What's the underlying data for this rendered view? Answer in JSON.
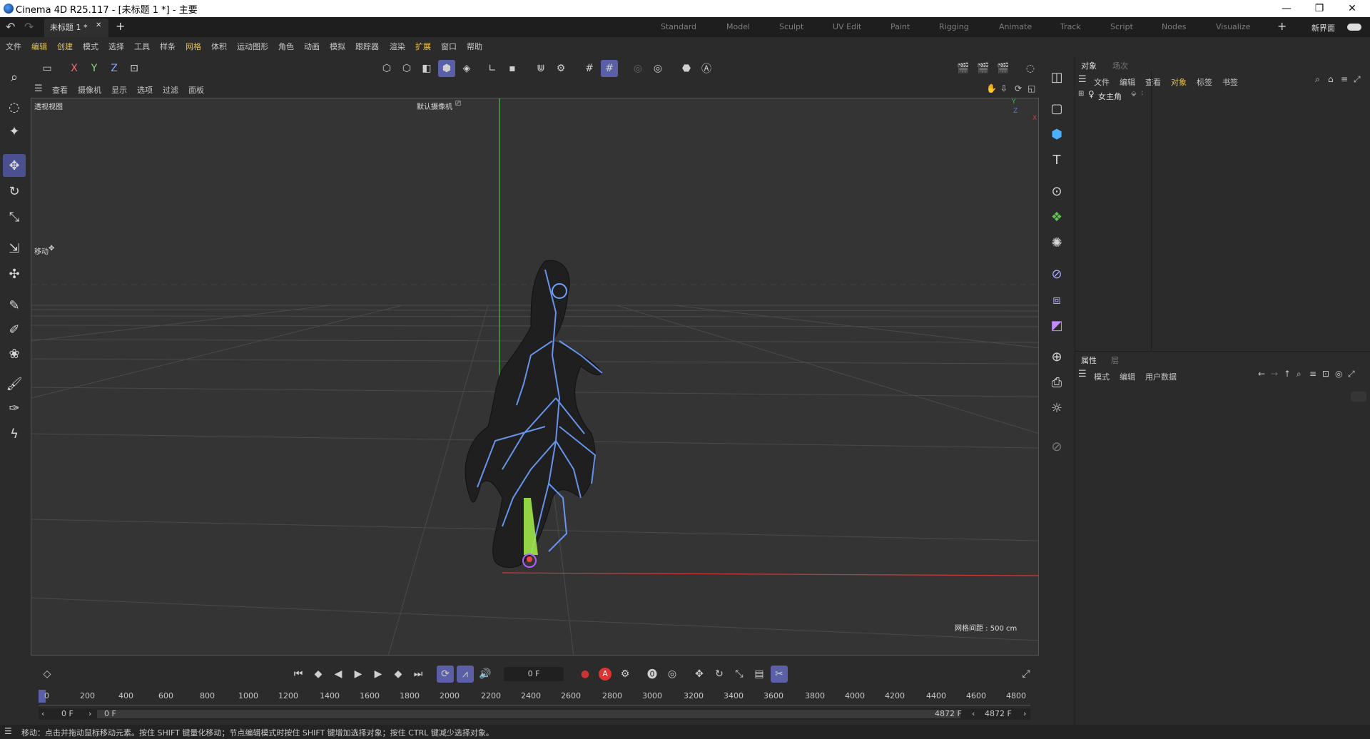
{
  "titlebar": {
    "title": "Cinema 4D R25.117 - [未标题 1 *] - 主要",
    "minimize": "—",
    "restore": "❐",
    "close": "✕"
  },
  "tabs": {
    "doc_tab": "未标题 1 *",
    "doc_close": "✕",
    "add": "+",
    "layouts": [
      "Standard",
      "Model",
      "Sculpt",
      "UV Edit",
      "Paint",
      "Rigging",
      "Animate",
      "Track",
      "Script",
      "Nodes",
      "Visualize"
    ],
    "layout_add": "+",
    "new_ui": "新界面"
  },
  "menu": [
    "文件",
    "编辑",
    "创建",
    "模式",
    "选择",
    "工具",
    "样条",
    "网格",
    "体积",
    "运动图形",
    "角色",
    "动画",
    "模拟",
    "跟踪器",
    "渲染",
    "扩展",
    "窗口",
    "帮助"
  ],
  "axis_lock": {
    "x": "X",
    "y": "Y",
    "z": "Z"
  },
  "viewport_menu": [
    "查看",
    "摄像机",
    "显示",
    "选项",
    "过滤",
    "面板"
  ],
  "viewport": {
    "view_name": "透视视图",
    "camera": "默认摄像机",
    "move_label": "移动",
    "grid_spacing": "网格间距 : 500 cm",
    "axis_y": "Y",
    "axis_z": "Z",
    "axis_x": "X"
  },
  "timeline": {
    "frame_field": "0 F",
    "ruler": [
      "0",
      "200",
      "400",
      "600",
      "800",
      "1000",
      "1200",
      "1400",
      "1600",
      "1800",
      "2000",
      "2200",
      "2400",
      "2600",
      "2800",
      "3000",
      "3200",
      "3400",
      "3600",
      "3800",
      "4000",
      "4200",
      "4400",
      "4600",
      "4800"
    ],
    "range_start": "0 F",
    "range_start2": "0 F",
    "range_end": "4872 F",
    "range_end2": "4872 F",
    "record_label": "A"
  },
  "object_panel": {
    "tabs": [
      "对象",
      "场次"
    ],
    "menu": [
      "文件",
      "编辑",
      "查看",
      "对象",
      "标签",
      "书签"
    ],
    "objects": [
      {
        "name": "女主角"
      }
    ]
  },
  "attr_panel": {
    "tabs": [
      "属性",
      "层"
    ],
    "menu": [
      "模式",
      "编辑",
      "用户数据"
    ]
  },
  "status": "移动：点击并拖动鼠标移动元素。按住 SHIFT 键量化移动；节点编辑模式时按住 SHIFT 键增加选择对象；按住 CTRL 键减少选择对象。",
  "colors": {
    "accent": "#5a5fa8",
    "menu_highlight": "#e8c34c",
    "x_axis": "#d23a3a",
    "y_axis": "#3ac23a",
    "skeleton": "#6fa0ff"
  }
}
